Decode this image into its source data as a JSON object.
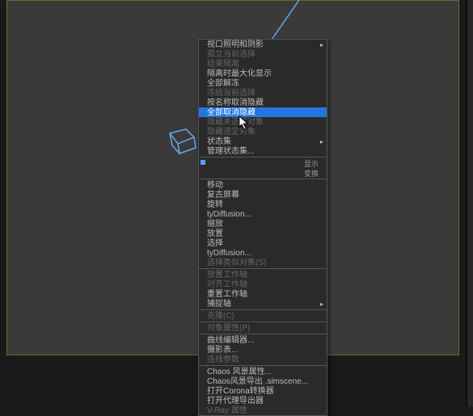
{
  "menu": {
    "items": [
      {
        "label": "视口照明和阴影",
        "submenu": true
      },
      {
        "label": "孤立当前选择",
        "disabled": true
      },
      {
        "label": "结束隔离",
        "disabled": true
      },
      {
        "label": "隔离时最大化显示"
      },
      {
        "label": "全部解冻"
      },
      {
        "label": "冻结当前选择",
        "disabled": true
      },
      {
        "label": "按名称取消隐藏"
      },
      {
        "label": "全部取消隐藏",
        "highlighted": true
      },
      {
        "label": "隐藏未选定对象",
        "disabled": true
      },
      {
        "label": "隐藏选定对象",
        "disabled": true
      },
      {
        "label": "状态集",
        "submenu": true
      },
      {
        "label": "管理状态集..."
      },
      {
        "sep": true
      },
      {
        "label": "显示",
        "right": true,
        "check": true
      },
      {
        "label": "变换",
        "right": true
      },
      {
        "sep": true
      },
      {
        "label": "移动"
      },
      {
        "label": "复古屏幕"
      },
      {
        "label": "旋转"
      },
      {
        "label": "tyDiffusion..."
      },
      {
        "label": "缩放"
      },
      {
        "label": "放置"
      },
      {
        "label": "选择"
      },
      {
        "label": "tyDiffusion..."
      },
      {
        "label": "选择类似对象(S)",
        "disabled": true
      },
      {
        "sep": true
      },
      {
        "label": "放置工作轴",
        "disabled": true
      },
      {
        "label": "对齐工作轴",
        "disabled": true
      },
      {
        "label": "重置工作轴"
      },
      {
        "label": "捕捉轴",
        "submenu": true
      },
      {
        "sep": true
      },
      {
        "label": "克隆(C)",
        "disabled": true
      },
      {
        "sep": true
      },
      {
        "label": "对象属性(P)",
        "disabled": true
      },
      {
        "sep": true
      },
      {
        "label": "曲线编辑器..."
      },
      {
        "label": "摄影表..."
      },
      {
        "label": "连线参数",
        "disabled": true
      },
      {
        "sep": true
      },
      {
        "label": "Chaos 风景属性..."
      },
      {
        "label": "Chaos风景导出 .simscene..."
      },
      {
        "label": "打开Corona转换器"
      },
      {
        "label": "打开代理导出器"
      },
      {
        "label": "V-Ray 属性",
        "disabled": true
      }
    ]
  }
}
